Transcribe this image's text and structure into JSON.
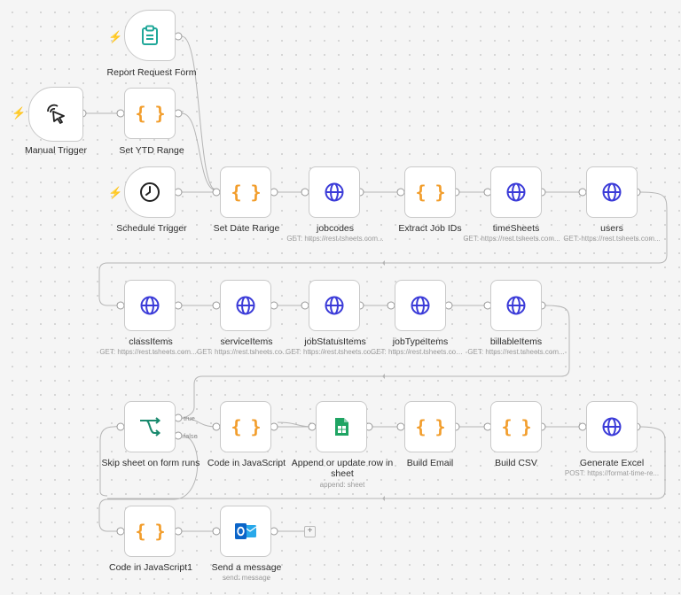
{
  "canvas": {
    "nodes": [
      {
        "id": "report-request-form",
        "label": "Report Request Form",
        "subtitle": "",
        "icon": "form-clipboard-icon",
        "trigger": true
      },
      {
        "id": "manual-trigger",
        "label": "Manual Trigger",
        "subtitle": "",
        "icon": "cursor-click-icon",
        "trigger": true
      },
      {
        "id": "set-ytd-range",
        "label": "Set YTD Range",
        "subtitle": "",
        "icon": "code-braces-icon",
        "trigger": false
      },
      {
        "id": "schedule-trigger",
        "label": "Schedule Trigger",
        "subtitle": "",
        "icon": "clock-icon",
        "trigger": true
      },
      {
        "id": "set-date-range",
        "label": "Set Date Range",
        "subtitle": "",
        "icon": "code-braces-icon",
        "trigger": false
      },
      {
        "id": "jobcodes",
        "label": "jobcodes",
        "subtitle": "GET: https://rest.tsheets.com...",
        "icon": "globe-icon",
        "trigger": false
      },
      {
        "id": "extract-job-ids",
        "label": "Extract Job IDs",
        "subtitle": "",
        "icon": "code-braces-icon",
        "trigger": false
      },
      {
        "id": "timesheets",
        "label": "timeSheets",
        "subtitle": "GET: https://rest.tsheets.com...",
        "icon": "globe-icon",
        "trigger": false
      },
      {
        "id": "users",
        "label": "users",
        "subtitle": "GET: https://rest.tsheets.com...",
        "icon": "globe-icon",
        "trigger": false
      },
      {
        "id": "classitems",
        "label": "classItems",
        "subtitle": "GET: https://rest.tsheets.com...",
        "icon": "globe-icon",
        "trigger": false
      },
      {
        "id": "serviceitems",
        "label": "serviceItems",
        "subtitle": "GET: https://rest.tsheets.com...",
        "icon": "globe-icon",
        "trigger": false
      },
      {
        "id": "jobstatusitems",
        "label": "jobStatusItems",
        "subtitle": "GET: https://rest.tsheets.com...",
        "icon": "globe-icon",
        "trigger": false
      },
      {
        "id": "jobtypeitems",
        "label": "jobTypeItems",
        "subtitle": "GET: https://rest.tsheets.com...",
        "icon": "globe-icon",
        "trigger": false
      },
      {
        "id": "billableitems",
        "label": "billableItems",
        "subtitle": "GET: https://rest.tsheets.com...",
        "icon": "globe-icon",
        "trigger": false
      },
      {
        "id": "skip-sheet",
        "label": "Skip sheet on form runs",
        "subtitle": "",
        "icon": "if-branch-icon",
        "trigger": false
      },
      {
        "id": "code-in-javascript",
        "label": "Code in JavaScript",
        "subtitle": "",
        "icon": "code-braces-icon",
        "trigger": false
      },
      {
        "id": "append-sheet",
        "label": "Append or update row in sheet",
        "subtitle": "append: sheet",
        "icon": "google-sheets-icon",
        "trigger": false
      },
      {
        "id": "build-email",
        "label": "Build Email",
        "subtitle": "",
        "icon": "code-braces-icon",
        "trigger": false
      },
      {
        "id": "build-csv",
        "label": "Build CSV",
        "subtitle": "",
        "icon": "code-braces-icon",
        "trigger": false
      },
      {
        "id": "generate-excel",
        "label": "Generate Excel",
        "subtitle": "POST: https://format-time-re...",
        "icon": "globe-icon",
        "trigger": false
      },
      {
        "id": "code-in-javascript1",
        "label": "Code in JavaScript1",
        "subtitle": "",
        "icon": "code-braces-icon",
        "trigger": false
      },
      {
        "id": "send-a-message",
        "label": "Send a message",
        "subtitle": "send: message",
        "icon": "outlook-icon",
        "trigger": false
      }
    ],
    "branch_labels": {
      "true_label": "true",
      "false_label": "false"
    },
    "braces_glyph": "{ }",
    "add_button_label": "+",
    "colors": {
      "trigger_bolt": "#ff6d2d",
      "braces": "#f29d2b",
      "globe": "#3b3bd8",
      "form": "#21a89a",
      "sheets": "#1fa463",
      "outlook": "#0a64c8",
      "wire": "#b5b5b5"
    }
  }
}
